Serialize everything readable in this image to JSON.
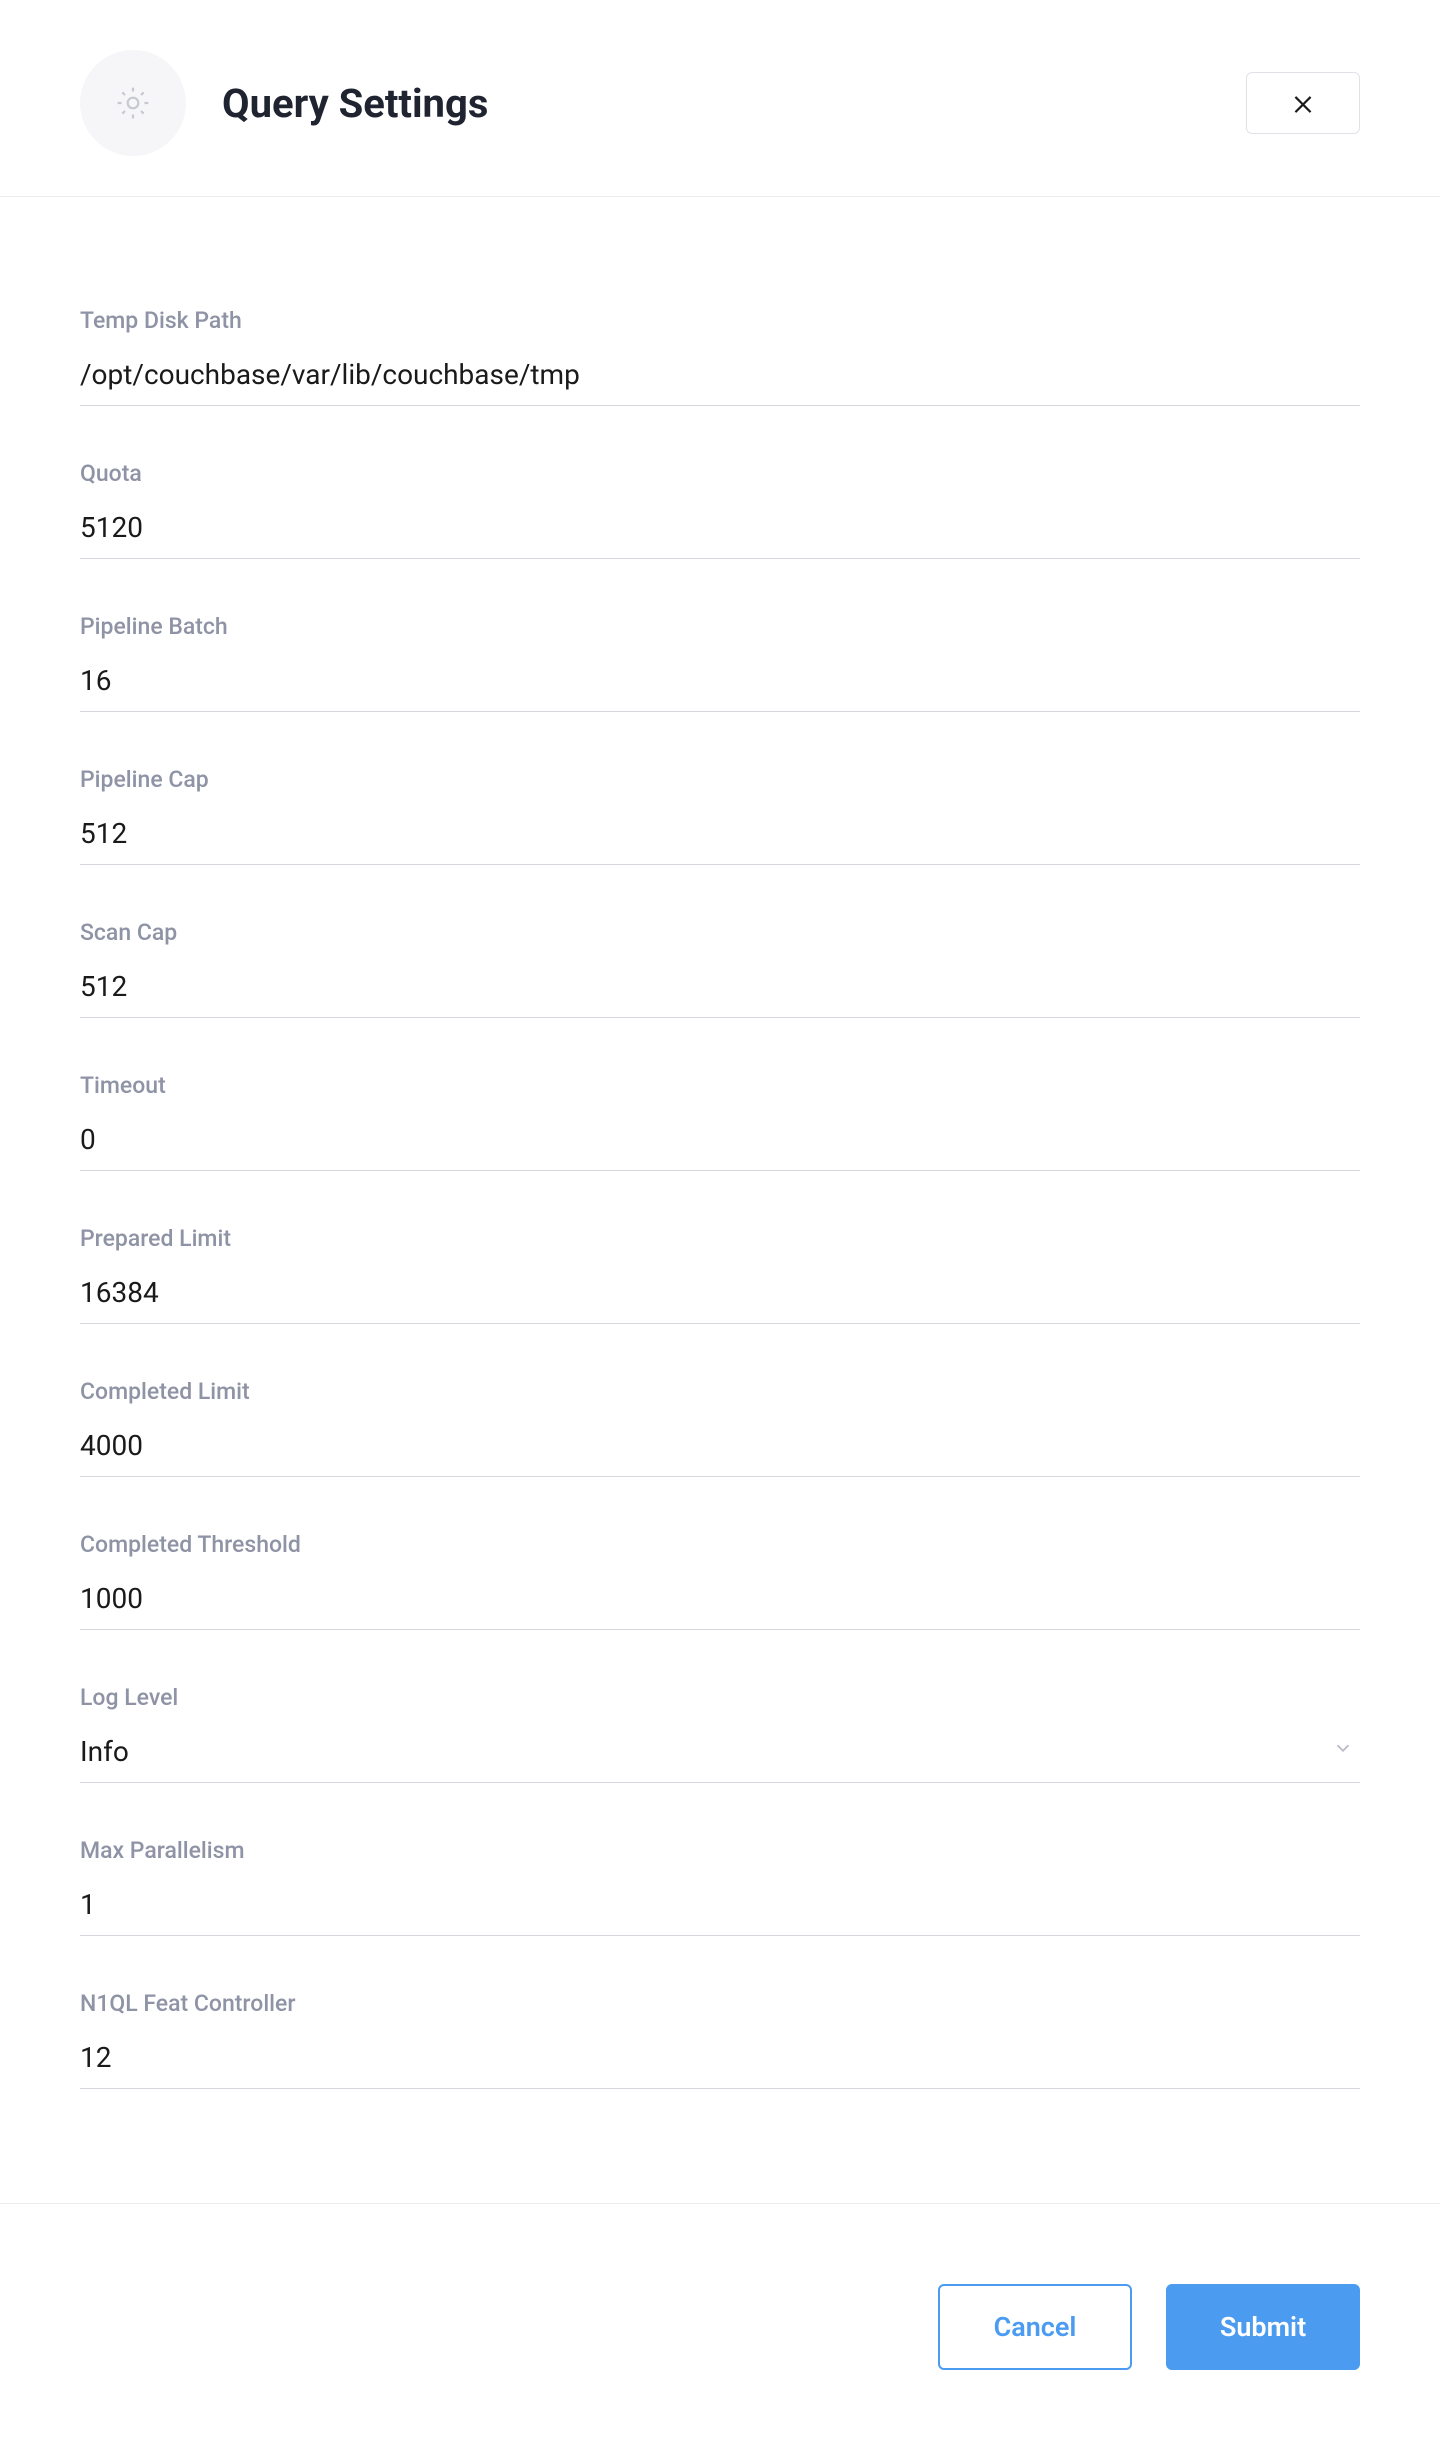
{
  "header": {
    "title": "Query Settings"
  },
  "fields": {
    "tempDiskPath": {
      "label": "Temp Disk Path",
      "value": "/opt/couchbase/var/lib/couchbase/tmp"
    },
    "quota": {
      "label": "Quota",
      "value": "5120"
    },
    "pipelineBatch": {
      "label": "Pipeline Batch",
      "value": "16"
    },
    "pipelineCap": {
      "label": "Pipeline Cap",
      "value": "512"
    },
    "scanCap": {
      "label": "Scan Cap",
      "value": "512"
    },
    "timeout": {
      "label": "Timeout",
      "value": "0"
    },
    "preparedLimit": {
      "label": "Prepared Limit",
      "value": "16384"
    },
    "completedLimit": {
      "label": "Completed Limit",
      "value": "4000"
    },
    "completedThreshold": {
      "label": "Completed Threshold",
      "value": "1000"
    },
    "logLevel": {
      "label": "Log Level",
      "value": "Info"
    },
    "maxParallelism": {
      "label": "Max Parallelism",
      "value": "1"
    },
    "n1qlFeatController": {
      "label": "N1QL Feat Controller",
      "value": "12"
    }
  },
  "footer": {
    "cancel": "Cancel",
    "submit": "Submit"
  }
}
